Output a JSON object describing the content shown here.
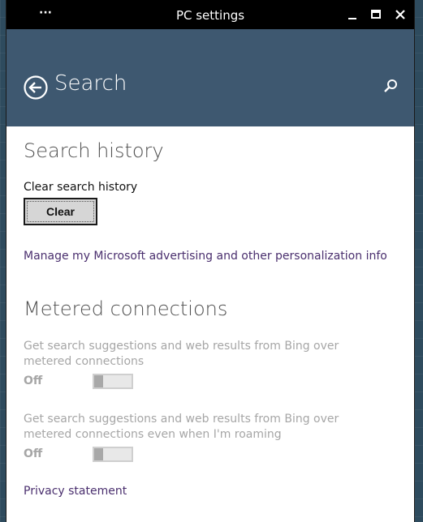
{
  "window": {
    "title": "PC settings",
    "menu_glyph": "···"
  },
  "header": {
    "page_title": "Search"
  },
  "search_history": {
    "section_title": "Search history",
    "clear_label": "Clear search history",
    "clear_button": "Clear",
    "manage_link": "Manage my Microsoft advertising and other personalization info"
  },
  "metered": {
    "section_title": "Metered connections",
    "settings": [
      {
        "description": "Get search suggestions and web results from Bing over metered connections",
        "state": "Off",
        "enabled": false
      },
      {
        "description": "Get search suggestions and web results from Bing over metered connections even when I'm roaming",
        "state": "Off",
        "enabled": false
      }
    ]
  },
  "privacy_link": "Privacy statement",
  "colors": {
    "header_bg": "#3e5870",
    "titlebar_bg": "#000000",
    "link": "#4a2f6e",
    "disabled_text": "#a6a6a6"
  }
}
